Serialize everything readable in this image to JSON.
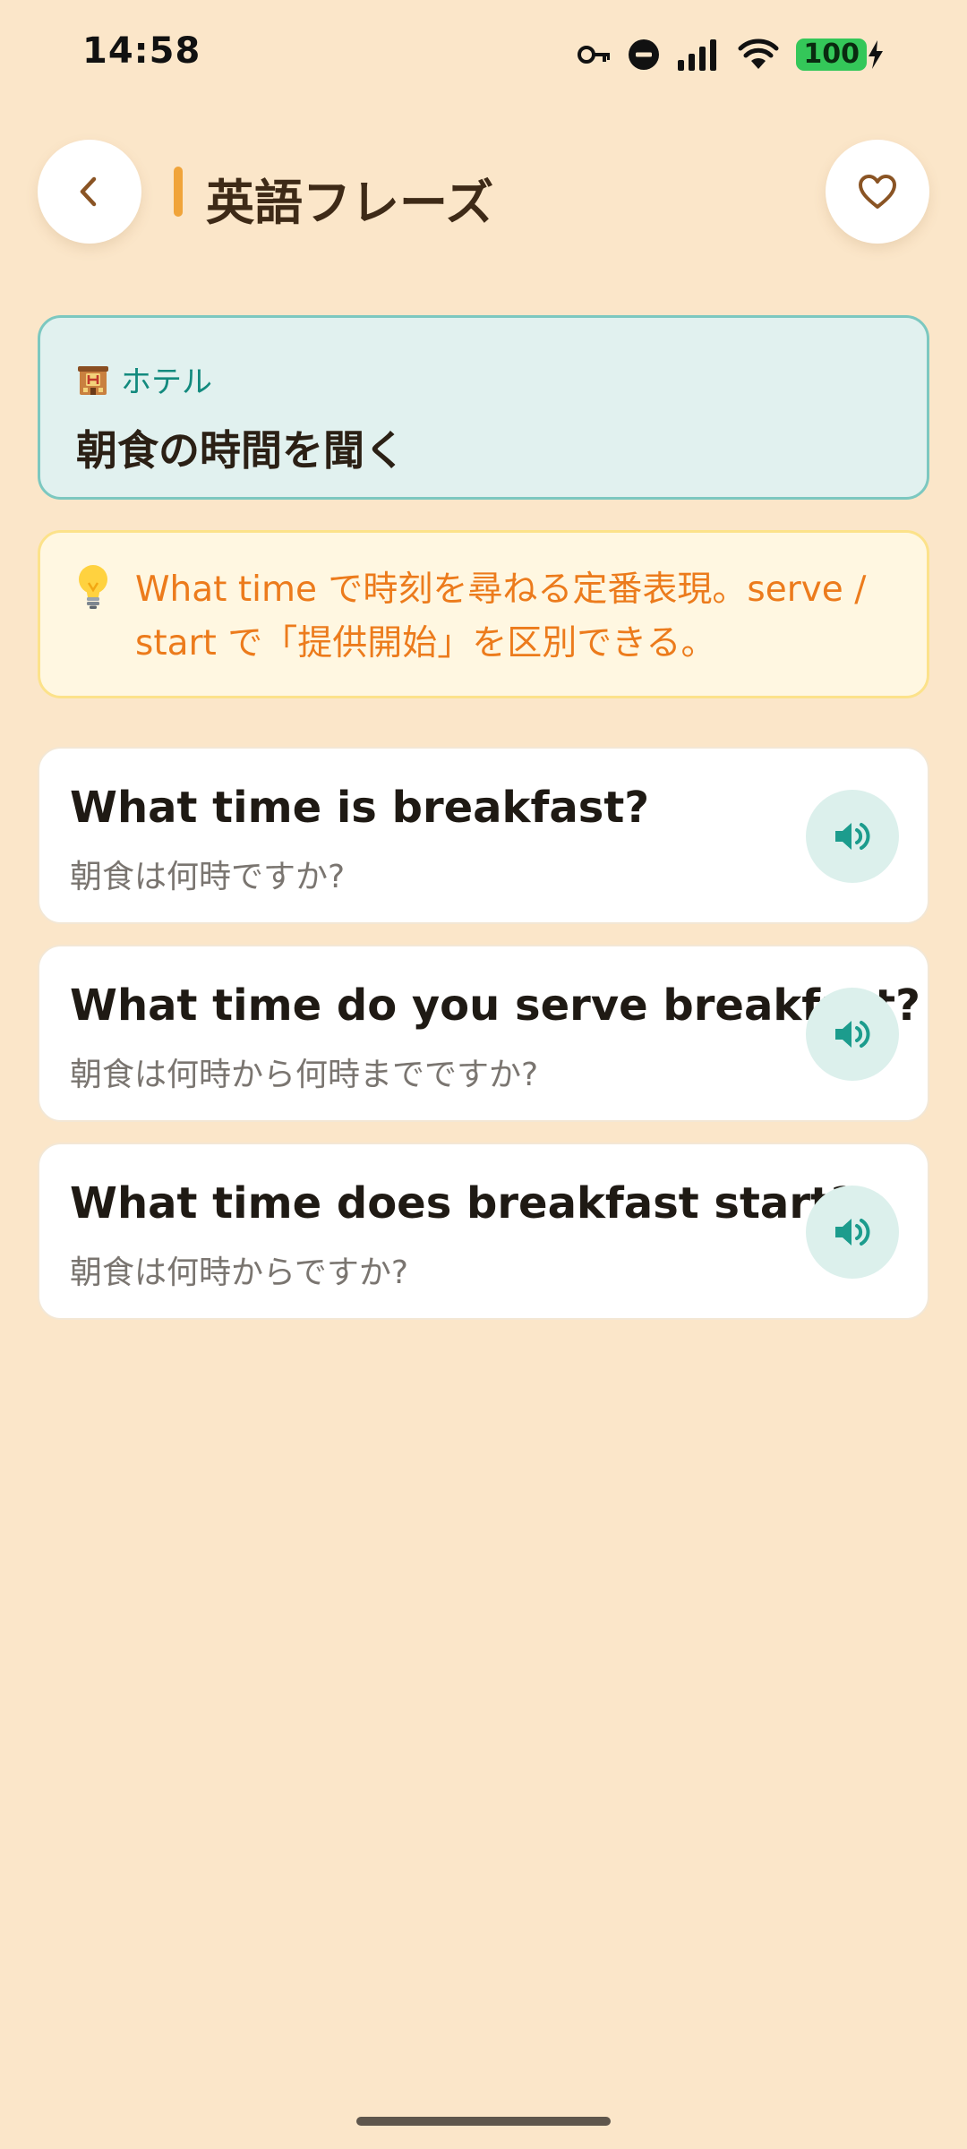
{
  "status_bar": {
    "time": "14:58",
    "battery_level": "100",
    "icons": [
      "key-icon",
      "do-not-disturb-icon",
      "signal-icon",
      "wifi-icon",
      "battery-charging-icon"
    ]
  },
  "header": {
    "title": "英語フレーズ",
    "back_icon": "chevron-left-icon",
    "favorite_icon": "heart-outline-icon"
  },
  "scene": {
    "category": "ホテル",
    "category_icon": "hotel-icon",
    "title": "朝食の時間を聞く"
  },
  "tip": {
    "icon": "light-bulb-icon",
    "line1": "What time で時刻を尋ねる定番表現。serve /",
    "line2": "start で「提供開始」を区別できる。"
  },
  "phrases": [
    {
      "english": "What time is breakfast?",
      "japanese": "朝食は何時ですか?"
    },
    {
      "english": "What time do you serve breakfast?",
      "japanese": "朝食は何時から何時までですか?"
    },
    {
      "english": "What time does breakfast start?",
      "japanese": "朝食は何時からですか?"
    }
  ],
  "colors": {
    "background": "#fbe6c9",
    "accent": "#f0a43a",
    "teal": "#138a7e",
    "tip_text": "#ec7b1c"
  }
}
